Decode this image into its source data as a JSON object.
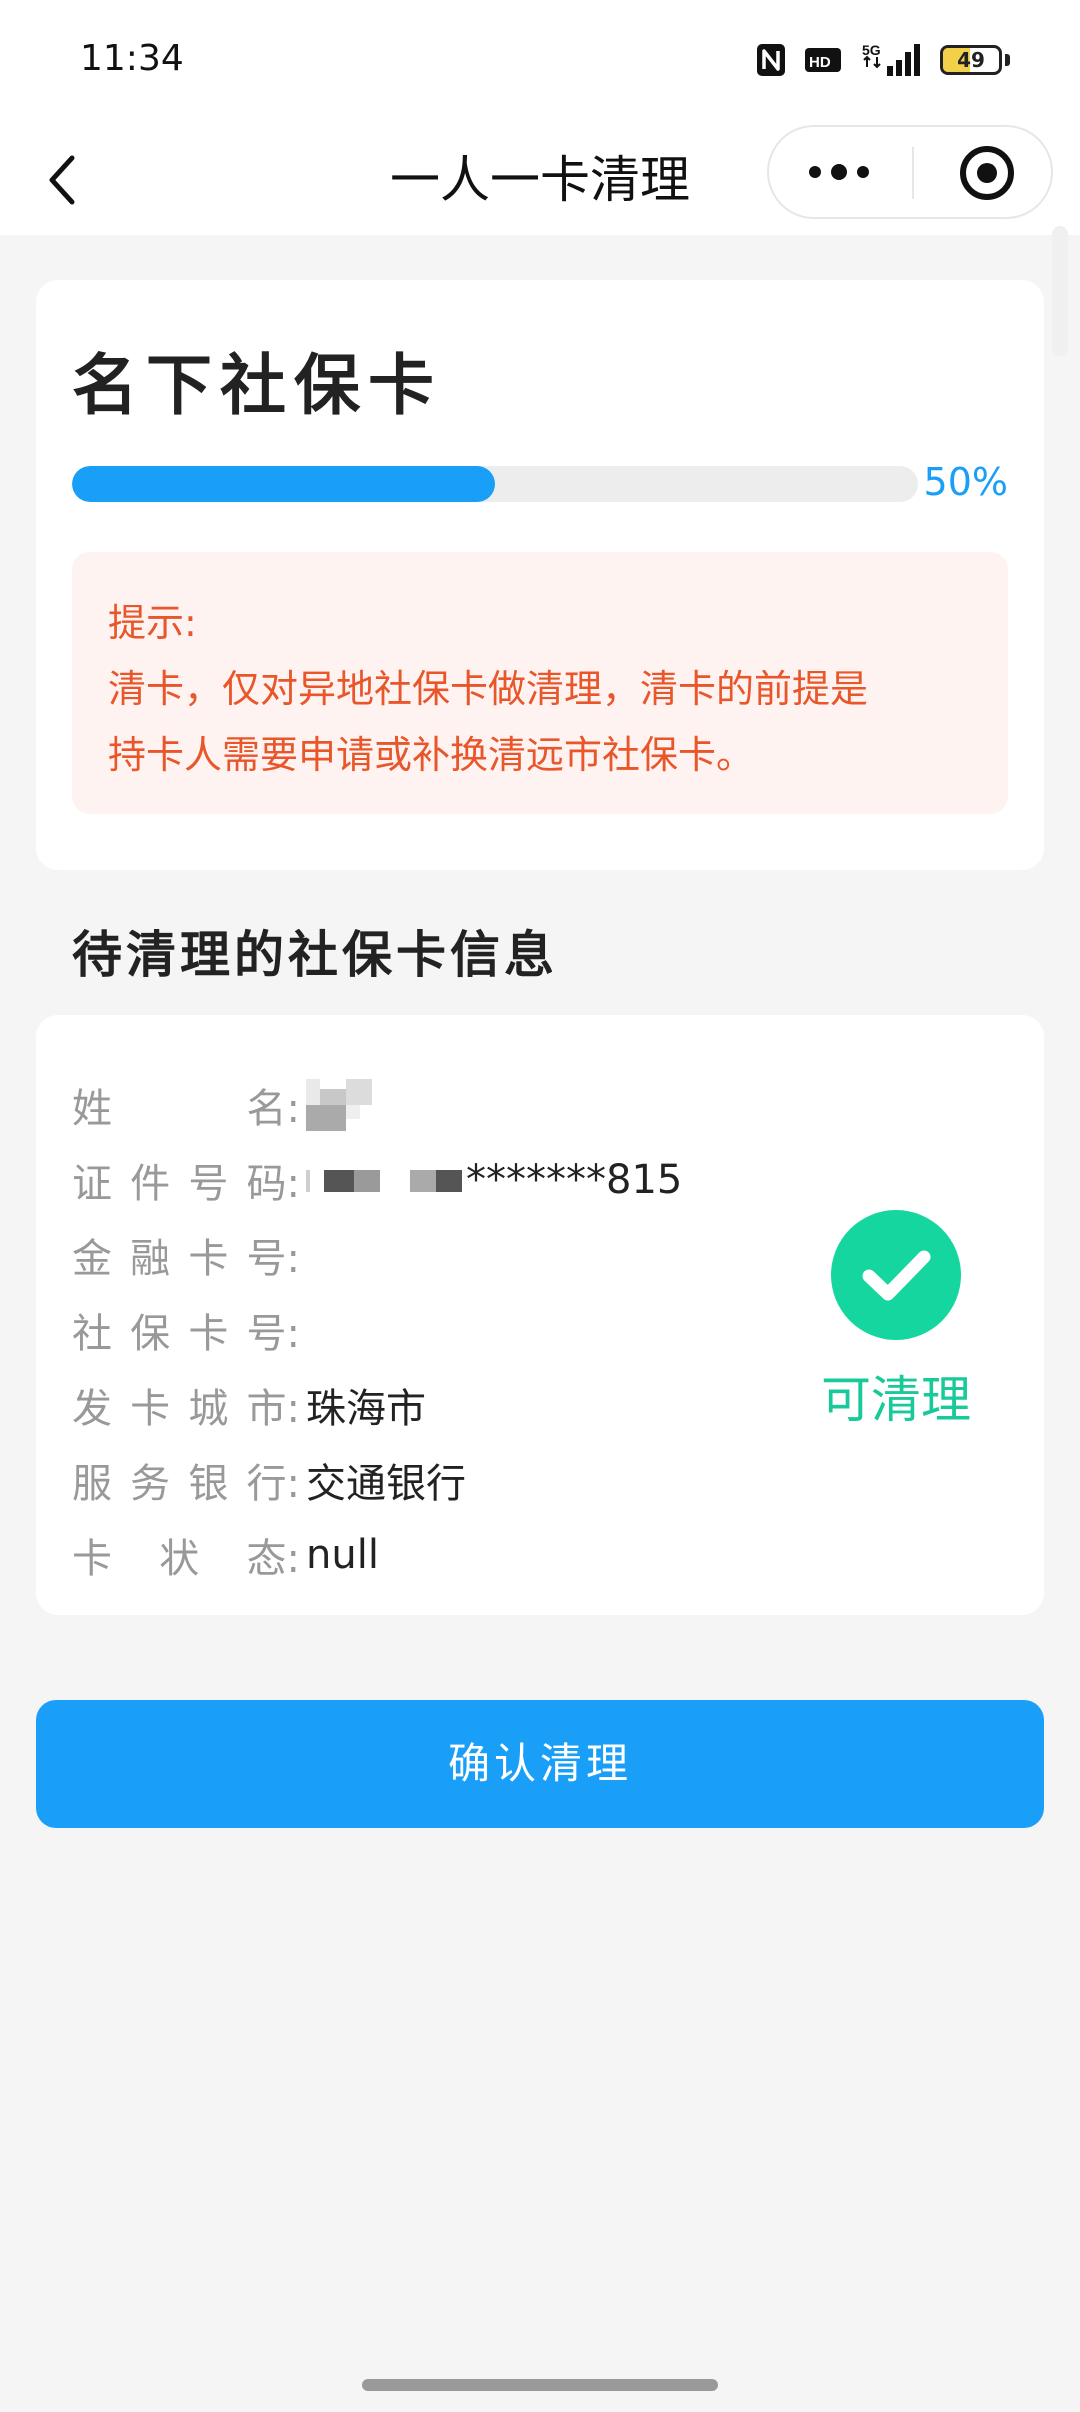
{
  "status_bar": {
    "time": "11:34",
    "battery_level": "49",
    "battery_fraction": 0.49,
    "icons": [
      "nfc-icon",
      "hd-icon",
      "signal-5g-icon",
      "battery-icon"
    ]
  },
  "nav": {
    "title": "一人一卡清理",
    "icons": [
      "back-chevron-icon",
      "more-dots-icon",
      "close-target-icon"
    ]
  },
  "summary_card": {
    "title": "名下社保卡",
    "progress_value": 0.5,
    "progress_label": "50%",
    "notice_lines": [
      "提示:",
      "清卡，仅对异地社保卡做清理，清卡的前提是",
      "持卡人需要申请或补换清远市社保卡。"
    ]
  },
  "section_title": "待清理的社保卡信息",
  "info_card": {
    "fields": [
      {
        "label": "姓名",
        "value": ""
      },
      {
        "label": "证件号码",
        "value": "*******815"
      },
      {
        "label": "金融卡号",
        "value": ""
      },
      {
        "label": "社保卡号",
        "value": ""
      },
      {
        "label": "发卡城市",
        "value": "珠海市"
      },
      {
        "label": "服务银行",
        "value": "交通银行"
      },
      {
        "label": "卡状态",
        "value": "null"
      }
    ],
    "status_text": "可清理",
    "status_icon": "check-circle-icon"
  },
  "confirm_button": "确认清理",
  "colors": {
    "primary": "#1a9ff8",
    "notice_text": "#e8562a",
    "notice_bg": "#fff3f1",
    "success": "#16d6a0"
  }
}
